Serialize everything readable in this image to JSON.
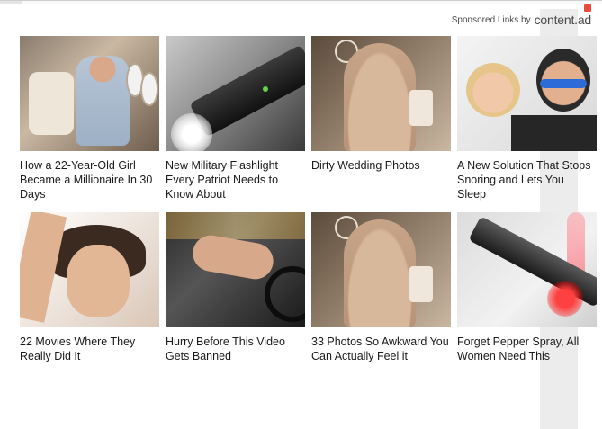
{
  "header": {
    "sponsored_label": "Sponsored Links by",
    "brand": "content.ad",
    "brand_flag_icon": "red-flag-icon"
  },
  "cards": [
    {
      "caption": "How a 22-Year-Old Girl Became a Millionaire In 30 Days",
      "thumb": "woman-in-private-jet"
    },
    {
      "caption": "New Military Flashlight Every Patriot Needs to Know About",
      "thumb": "tactical-flashlight"
    },
    {
      "caption": "Dirty Wedding Photos",
      "thumb": "woman-in-dress"
    },
    {
      "caption": "A New Solution That Stops Snoring and Lets You Sleep",
      "thumb": "couple-sleeping-snore-strap"
    },
    {
      "caption": "22 Movies Where They Really Did It",
      "thumb": "woman-expression"
    },
    {
      "caption": "Hurry Before This Video Gets Banned",
      "thumb": "woman-in-car"
    },
    {
      "caption": "33 Photos So Awkward You Can Actually Feel it",
      "thumb": "woman-in-dress"
    },
    {
      "caption": "Forget Pepper Spray, All Women Need This",
      "thumb": "glowing-device-smoke"
    }
  ]
}
